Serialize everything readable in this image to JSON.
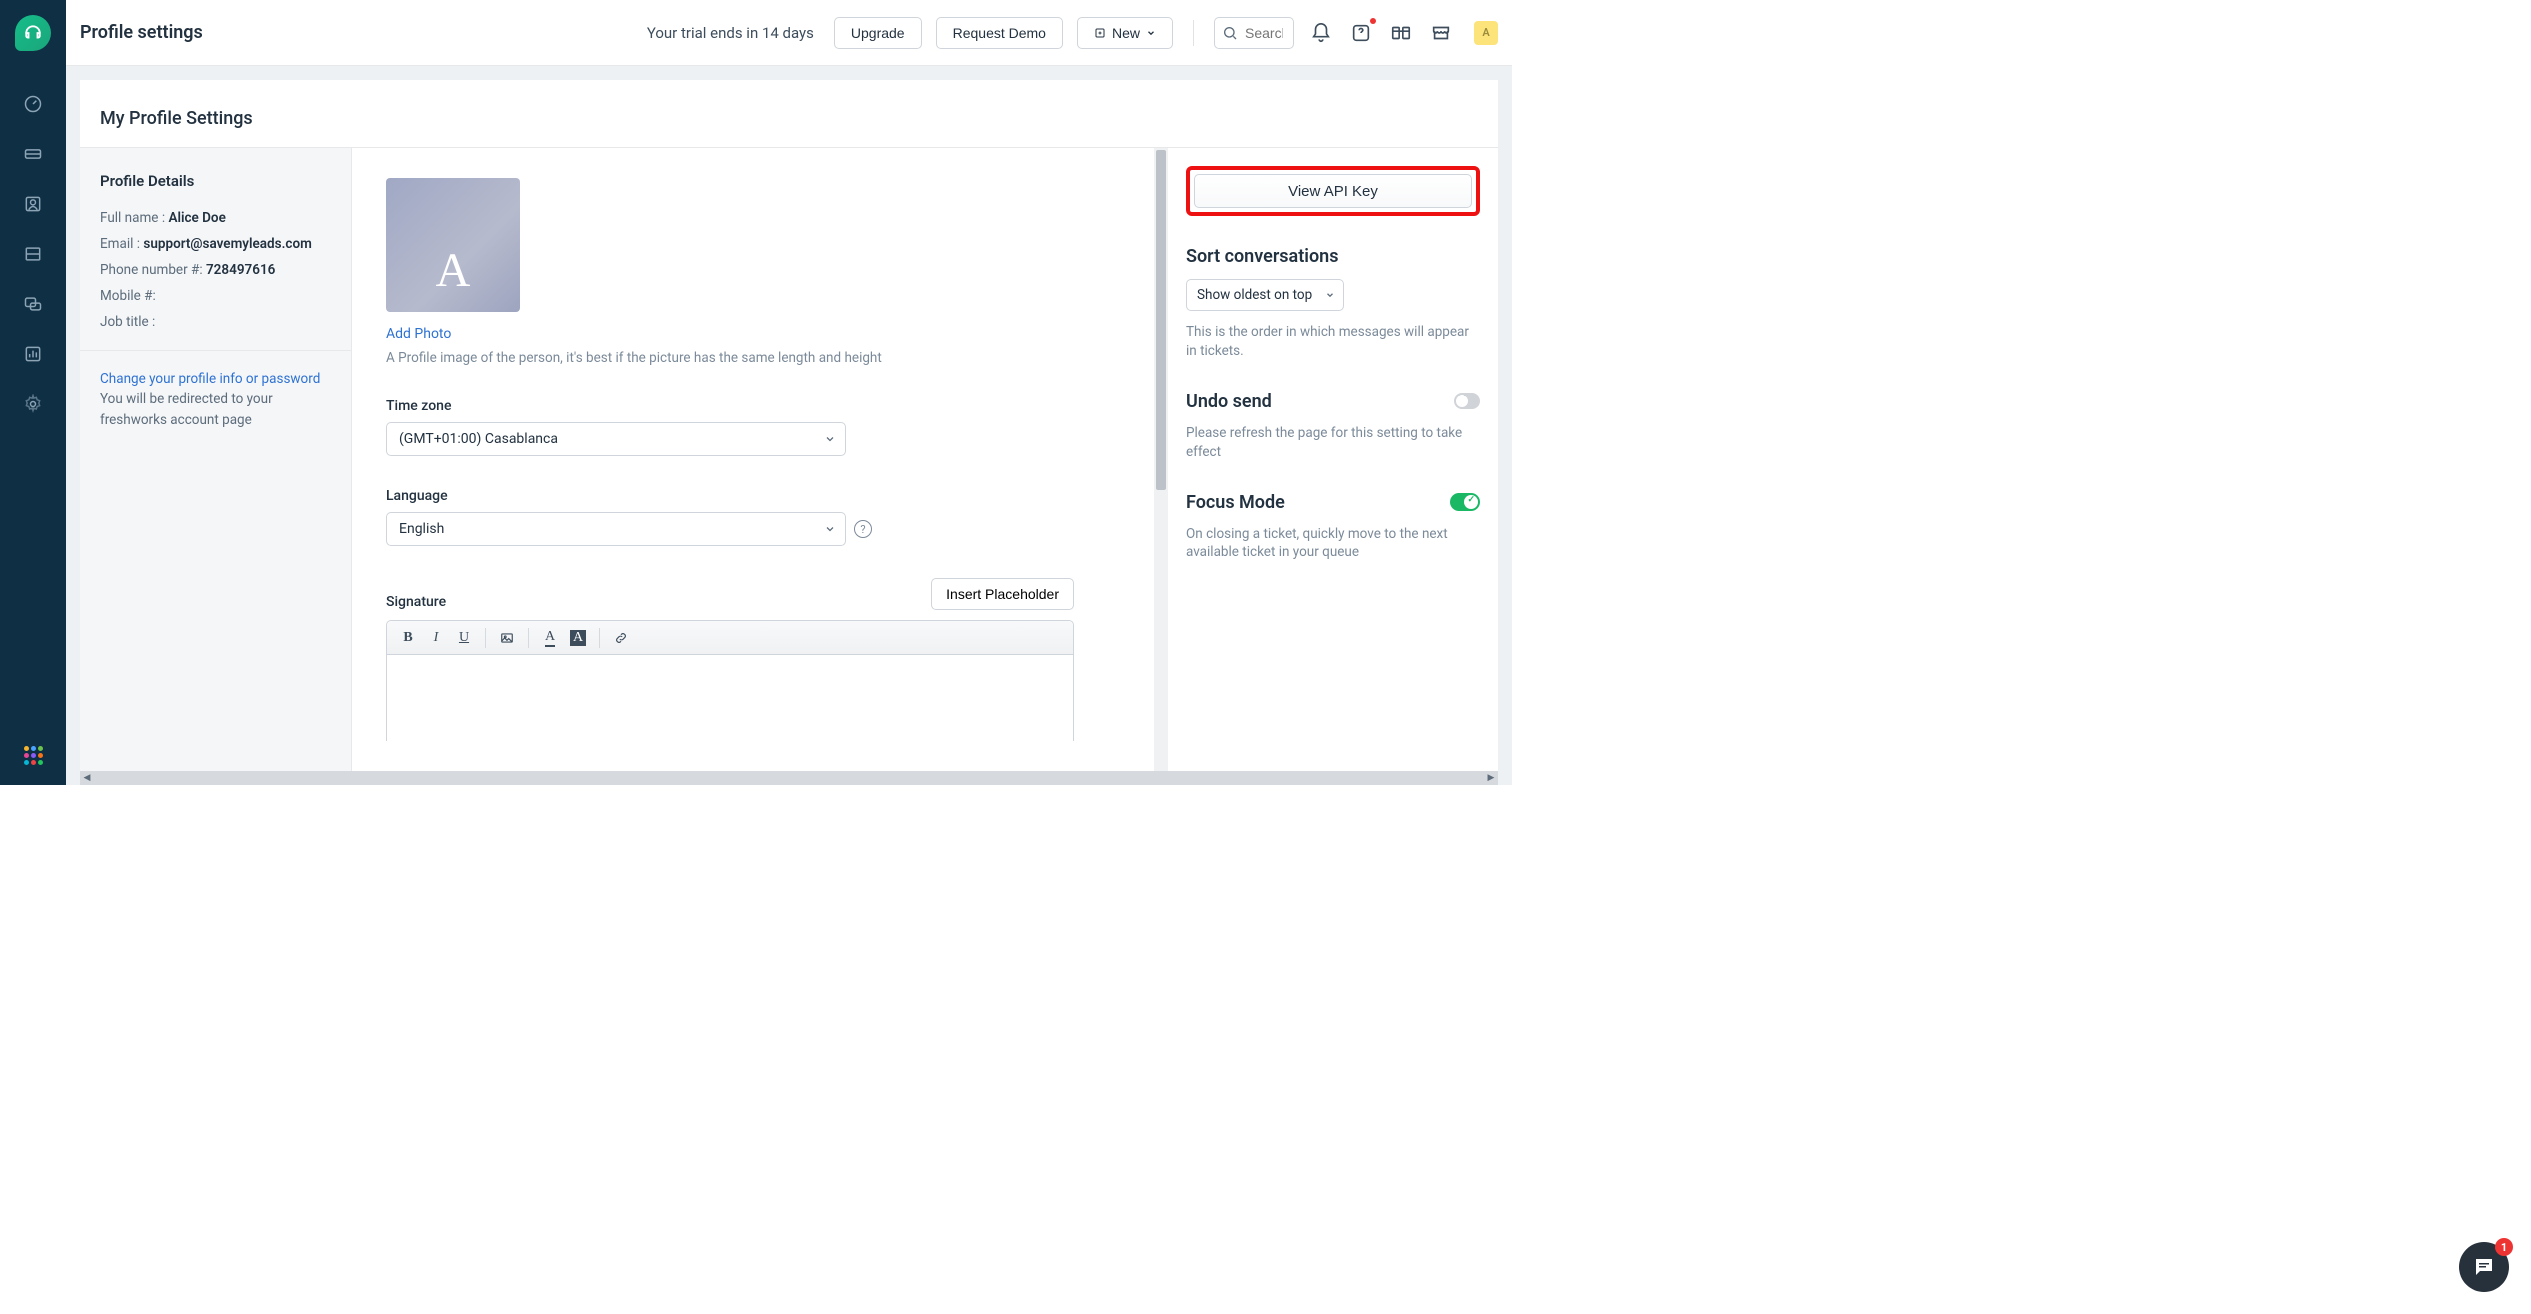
{
  "header": {
    "page_title": "Profile settings",
    "trial_text": "Your trial ends in 14 days",
    "upgrade": "Upgrade",
    "request_demo": "Request Demo",
    "new_label": "New",
    "search_placeholder": "Search",
    "avatar_letter": "A"
  },
  "section": {
    "title": "My Profile Settings"
  },
  "profile_details": {
    "heading": "Profile Details",
    "fullname_label": "Full name :",
    "fullname_value": "Alice Doe",
    "email_label": "Email :",
    "email_value": "support@savemyleads.com",
    "phone_label": "Phone number #:",
    "phone_value": "728497616",
    "mobile_label": "Mobile #:",
    "mobile_value": "",
    "job_label": "Job title :",
    "job_value": "",
    "change_link": "Change your profile info or password",
    "change_text": "You will be redirected to your freshworks account page"
  },
  "main_form": {
    "profile_letter": "A",
    "add_photo": "Add Photo",
    "photo_helper": "A Profile image of the person, it's best if the picture has the same length and height",
    "timezone_label": "Time zone",
    "timezone_value": "(GMT+01:00) Casablanca",
    "language_label": "Language",
    "language_value": "English",
    "signature_label": "Signature",
    "insert_placeholder": "Insert Placeholder"
  },
  "right": {
    "view_api": "View API Key",
    "sort_heading": "Sort conversations",
    "sort_value": "Show oldest on top",
    "sort_desc": "This is the order in which messages will appear in tickets.",
    "undo_heading": "Undo send",
    "undo_desc": "Please refresh the page for this setting to take effect",
    "focus_heading": "Focus Mode",
    "focus_desc": "On closing a ticket, quickly move to the next available ticket in your queue"
  },
  "chat": {
    "badge": "1"
  }
}
